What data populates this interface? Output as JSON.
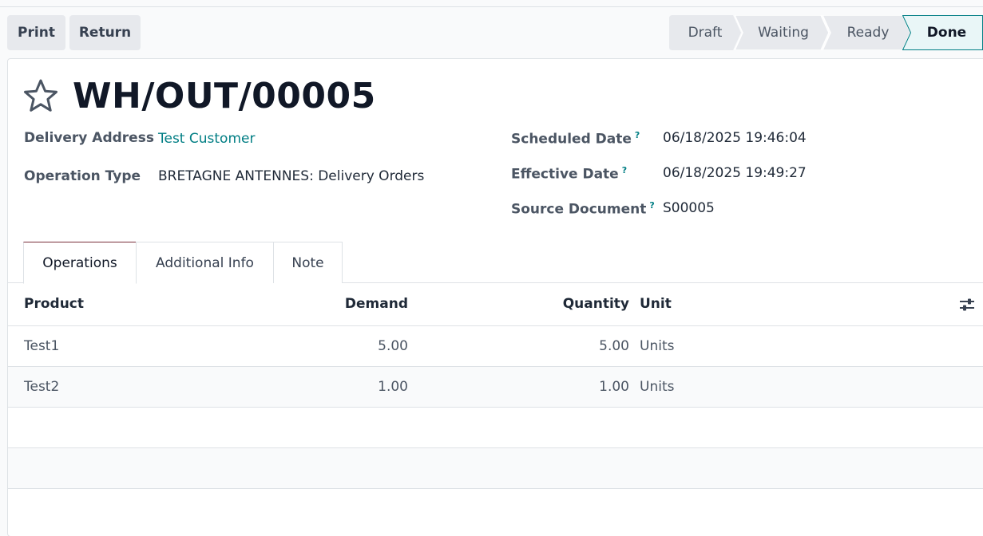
{
  "toolbar": {
    "print_label": "Print",
    "return_label": "Return"
  },
  "statusbar": {
    "stages": [
      "Draft",
      "Waiting",
      "Ready",
      "Done"
    ],
    "current": "Done"
  },
  "record": {
    "title": "WH/OUT/00005",
    "fields": {
      "delivery_address_label": "Delivery Address",
      "delivery_address": "Test Customer",
      "operation_type_label": "Operation Type",
      "operation_type": "BRETAGNE ANTENNES: Delivery Orders",
      "scheduled_date_label": "Scheduled Date",
      "scheduled_date": "06/18/2025 19:46:04",
      "effective_date_label": "Effective Date",
      "effective_date": "06/18/2025 19:49:27",
      "source_document_label": "Source Document",
      "source_document": "S00005",
      "help_marker": "?"
    }
  },
  "tabs": [
    "Operations",
    "Additional Info",
    "Note"
  ],
  "table": {
    "columns": [
      "Product",
      "Demand",
      "Quantity",
      "Unit"
    ],
    "rows": [
      {
        "product": "Test1",
        "demand": "5.00",
        "quantity": "5.00",
        "unit": "Units"
      },
      {
        "product": "Test2",
        "demand": "1.00",
        "quantity": "1.00",
        "unit": "Units"
      }
    ]
  },
  "colors": {
    "accent": "#017e84",
    "active_tab_border": "#7a2e3a",
    "stage_done_bg": "#e9f6f7"
  },
  "icons": {
    "favorite": "star-outline-icon",
    "column_settings": "sliders-icon"
  }
}
